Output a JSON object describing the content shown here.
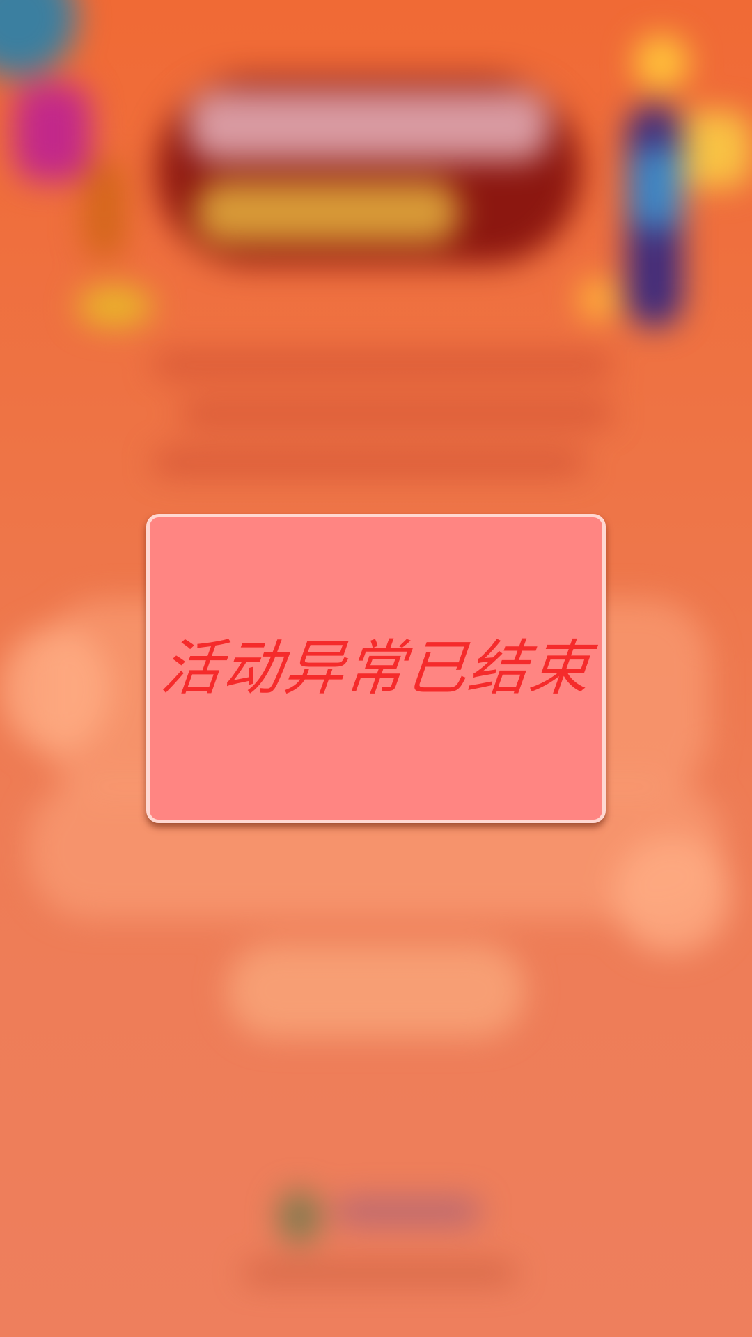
{
  "dialog": {
    "message": "活动异常已结束"
  },
  "colors": {
    "background": "#ef7c52",
    "modal_fill": "#ff8582",
    "modal_border": "#ffd8d2",
    "message_text": "#f52b2b"
  }
}
